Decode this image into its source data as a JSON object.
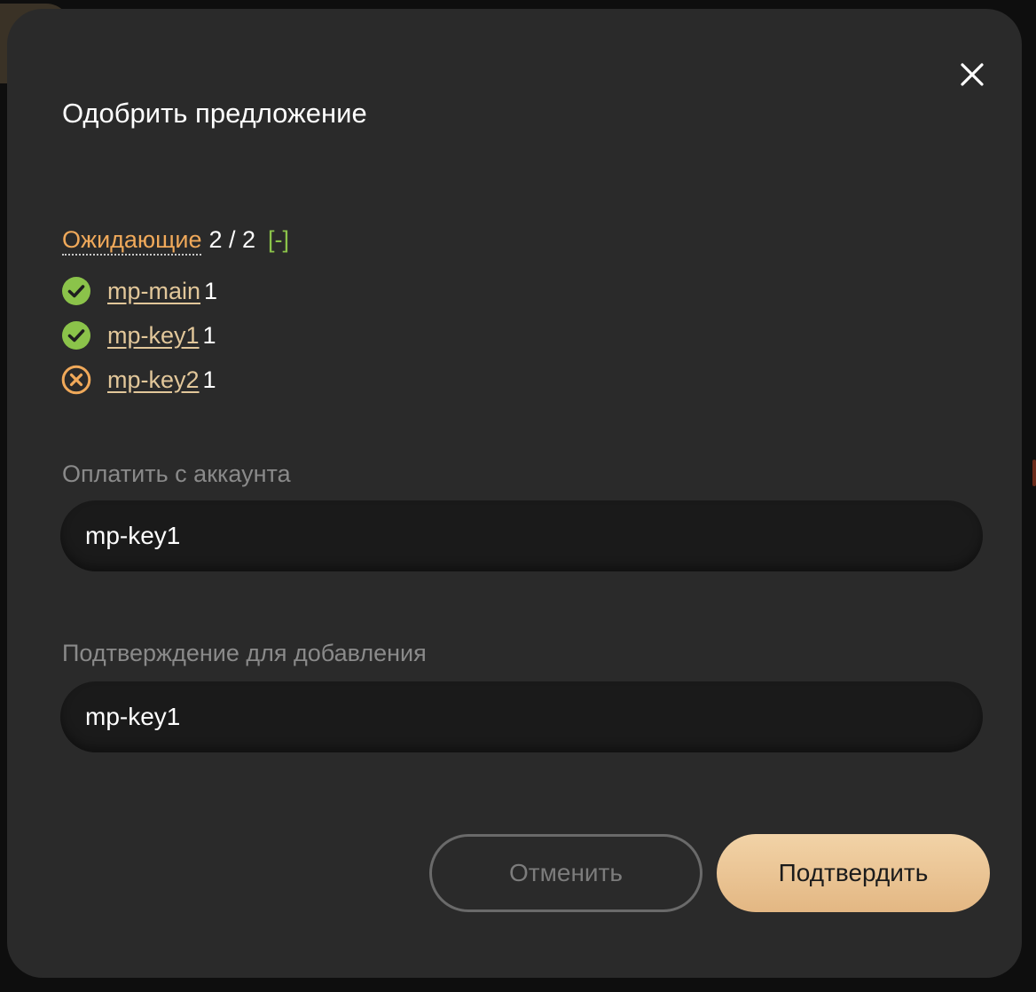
{
  "modal": {
    "title": "Одобрить предложение",
    "close_icon": "close-icon"
  },
  "pending": {
    "label": "Ожидающие",
    "count": "2 / 2",
    "toggle": "[-]"
  },
  "signers": [
    {
      "name": "mp-main",
      "weight": "1",
      "status": "approved",
      "icon": "check-circle-icon",
      "color": "#8bc34a"
    },
    {
      "name": "mp-key1",
      "weight": "1",
      "status": "approved",
      "icon": "check-circle-icon",
      "color": "#8bc34a"
    },
    {
      "name": "mp-key2",
      "weight": "1",
      "status": "pending",
      "icon": "x-circle-icon",
      "color": "#f0a95a"
    }
  ],
  "pay_from": {
    "label": "Оплатить с аккаунта",
    "value": "mp-key1"
  },
  "confirm_add": {
    "label": "Подтверждение для добавления",
    "value": "mp-key1"
  },
  "buttons": {
    "cancel": "Отменить",
    "confirm": "Подтвердить"
  },
  "colors": {
    "accent": "#e3b783",
    "pending_label": "#f0a95a",
    "approved": "#8bc34a",
    "modal_bg": "#2a2a2a",
    "input_bg": "#1a1a1a"
  }
}
